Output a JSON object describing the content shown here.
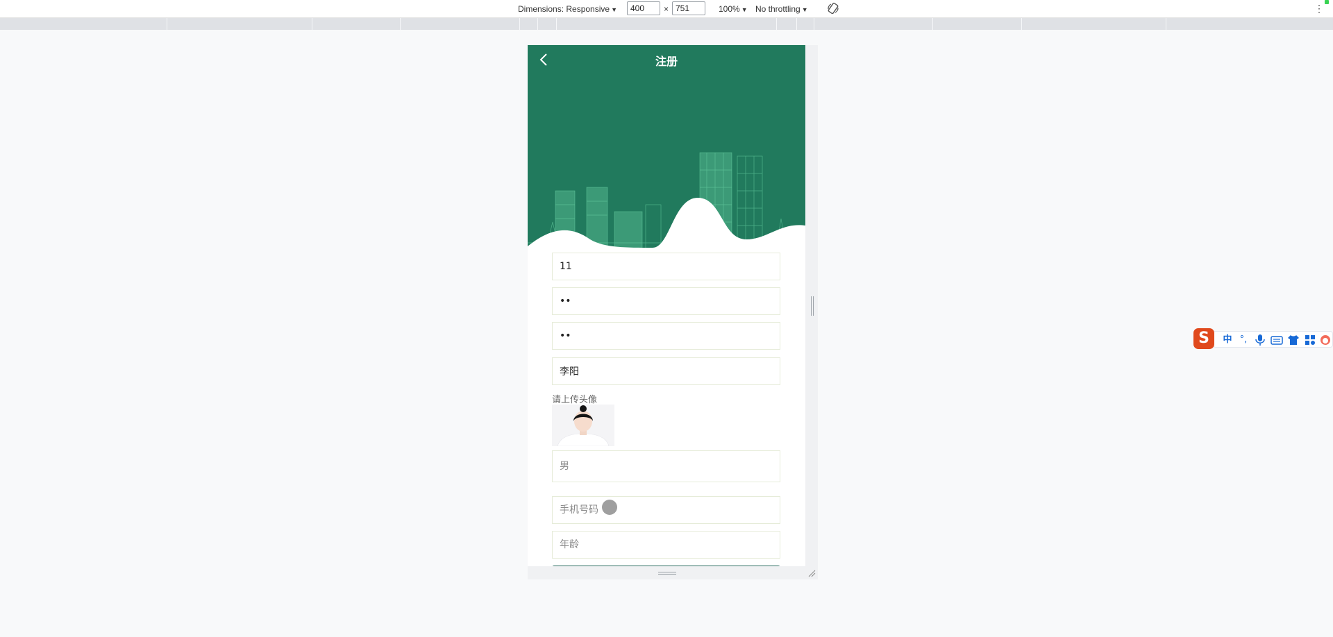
{
  "devtools": {
    "dimensions_label": "Dimensions: Responsive",
    "width_value": "400",
    "times_label": "×",
    "height_value": "751",
    "zoom_label": "100%",
    "throttling_label": "No throttling"
  },
  "page": {
    "title": "注册"
  },
  "form": {
    "username_value": "11",
    "password_value": "••",
    "confirm_password_value": "••",
    "name_value": "李阳",
    "avatar_label": "请上传头像",
    "gender_value": "男",
    "phone_placeholder": "手机号码",
    "age_placeholder": "年龄"
  },
  "ime": {
    "logo": "S",
    "chinese_mode": "中",
    "punctuation": "°,"
  },
  "colors": {
    "header_green": "#217a5d",
    "field_border": "#e6ecd9",
    "button_green": "#2b6e61"
  }
}
